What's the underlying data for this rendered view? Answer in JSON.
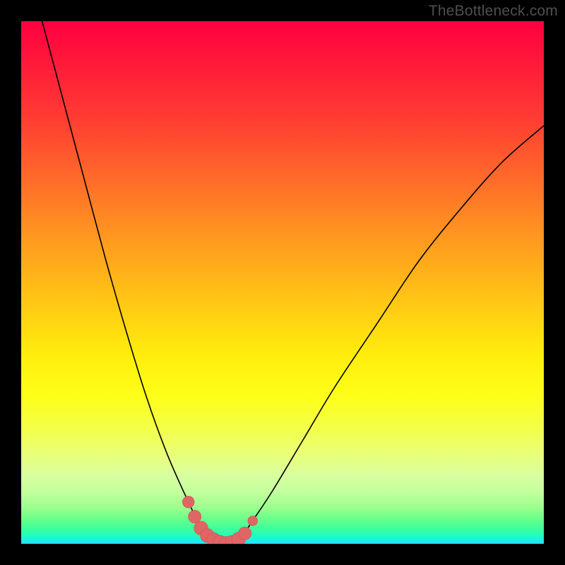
{
  "watermark": {
    "text": "TheBottleneck.com"
  },
  "colors": {
    "frame": "#000000",
    "curve_stroke": "#000000",
    "marker_fill": "#e06666",
    "marker_stroke": "#d85a5a",
    "watermark": "#4f4f4f"
  },
  "chart_data": {
    "type": "line",
    "title": "",
    "xlabel": "",
    "ylabel": "",
    "xlim": [
      0,
      100
    ],
    "ylim": [
      0,
      100
    ],
    "grid": false,
    "series": [
      {
        "name": "bottleneck-curve",
        "description": "V-shaped bottleneck curve; y≈0 is green (no bottleneck), y≈100 is red (severe). Flat optimum valley around x≈36–42.",
        "x": [
          0,
          4,
          8,
          12,
          16,
          20,
          24,
          28,
          32,
          34,
          36,
          38,
          40,
          42,
          44,
          48,
          54,
          60,
          68,
          76,
          84,
          92,
          100
        ],
        "y": [
          115,
          100,
          85,
          70,
          55,
          41,
          28,
          17,
          8,
          4,
          1,
          0,
          0,
          1,
          4,
          10,
          20,
          30,
          42,
          54,
          64,
          73,
          80
        ]
      }
    ],
    "markers": {
      "name": "optimum-range",
      "description": "Salmon markers along the valley floor indicating the balanced/optimum configuration range.",
      "points": [
        {
          "x": 32.0,
          "y": 8.0,
          "r": 1.1
        },
        {
          "x": 33.2,
          "y": 5.2,
          "r": 1.2
        },
        {
          "x": 34.4,
          "y": 3.0,
          "r": 1.3
        },
        {
          "x": 35.6,
          "y": 1.6,
          "r": 1.3
        },
        {
          "x": 36.8,
          "y": 0.8,
          "r": 1.3
        },
        {
          "x": 38.0,
          "y": 0.3,
          "r": 1.3
        },
        {
          "x": 39.2,
          "y": 0.1,
          "r": 1.3
        },
        {
          "x": 40.4,
          "y": 0.3,
          "r": 1.3
        },
        {
          "x": 41.6,
          "y": 0.9,
          "r": 1.3
        },
        {
          "x": 42.8,
          "y": 2.0,
          "r": 1.2
        },
        {
          "x": 44.3,
          "y": 4.4,
          "r": 0.9
        }
      ]
    },
    "gradient_stops_note": "Background encodes y-axis: top=red (bad), bottom=green/cyan (good)."
  }
}
